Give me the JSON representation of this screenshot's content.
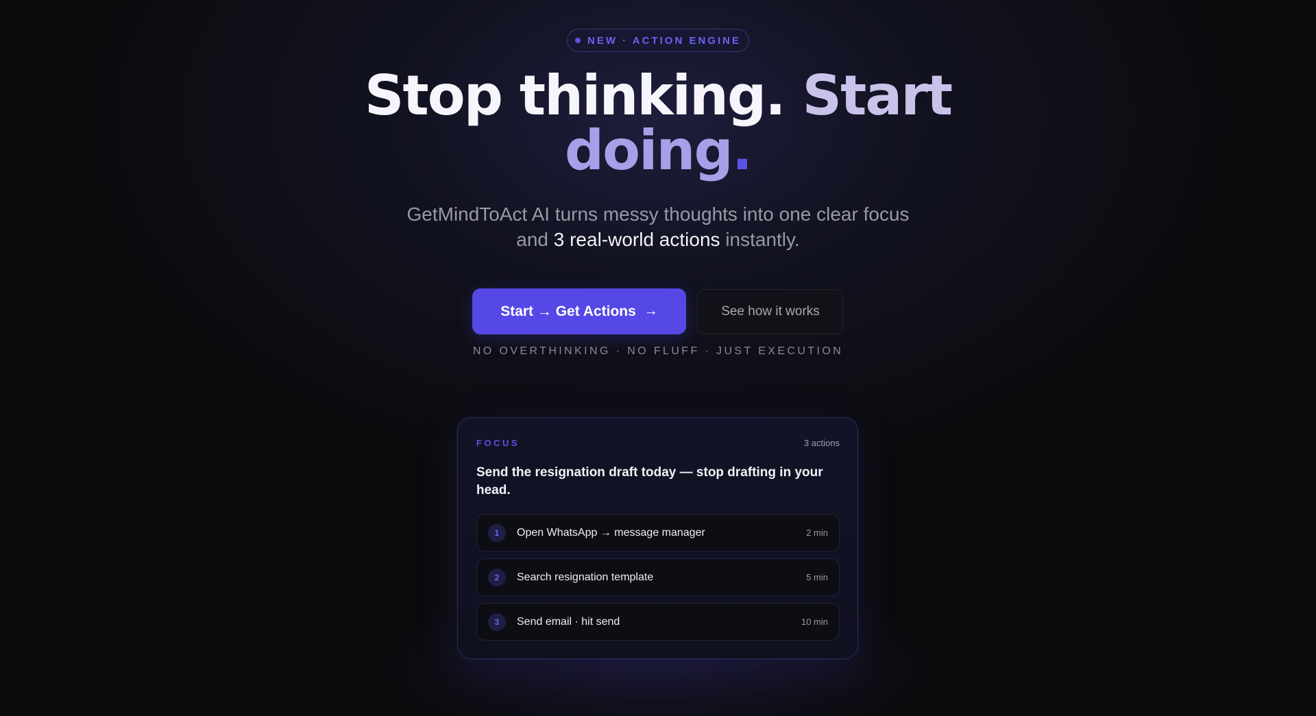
{
  "badge": {
    "text": "NEW · ACTION ENGINE"
  },
  "hero": {
    "title_part1": "Stop thinking.",
    "title_part2": "Start",
    "title_part3": "doing",
    "title_dot": "."
  },
  "subtitle": {
    "line1": "GetMindToAct AI turns messy thoughts into one clear focus",
    "pre": "and",
    "highlight": "3 real-world actions",
    "post": "instantly."
  },
  "buttons": {
    "primary_label": "Start → Get Actions",
    "primary_icon": "→",
    "secondary_label": "See how it works"
  },
  "tagline": "NO OVERTHINKING · NO FLUFF · JUST EXECUTION",
  "card": {
    "label": "FOCUS",
    "count": "3 actions",
    "headline": "Send the resignation draft today — stop drafting in your head.",
    "actions": [
      {
        "num": "1",
        "text": "Open WhatsApp → message manager",
        "time": "2 min"
      },
      {
        "num": "2",
        "text": "Search resignation template",
        "time": "5 min"
      },
      {
        "num": "3",
        "text": "Send email · hit send",
        "time": "10 min"
      }
    ]
  },
  "colors": {
    "accent": "#5648e6",
    "background": "#0b0b0d",
    "accent_text": "#5b53e6"
  }
}
